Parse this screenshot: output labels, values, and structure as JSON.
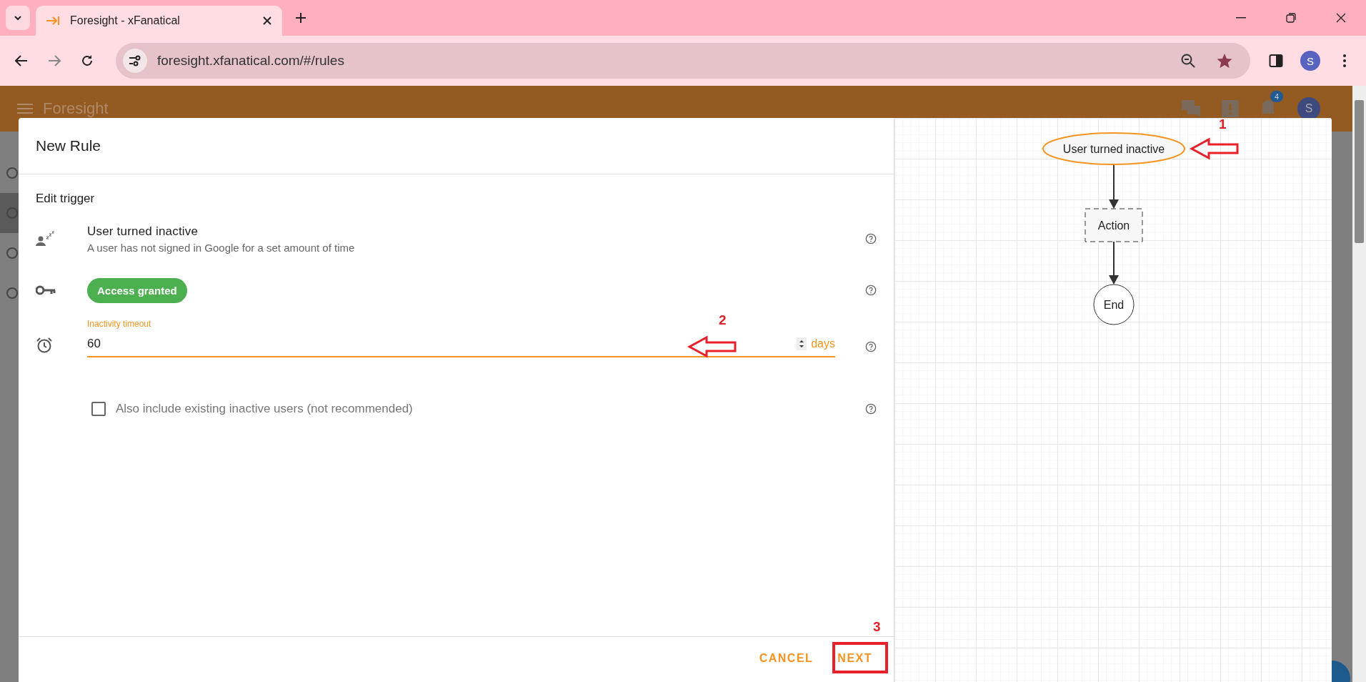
{
  "browser": {
    "tab_title": "Foresight - xFanatical",
    "url": "foresight.xfanatical.com/#/rules",
    "profile": "S"
  },
  "app_header": {
    "title": "Foresight",
    "notification_count": "4",
    "avatar": "S"
  },
  "sidebar": {
    "items": [
      {
        "selected": false
      },
      {
        "selected": true
      },
      {
        "selected": false
      },
      {
        "selected": false
      }
    ]
  },
  "dialog": {
    "title": "New Rule",
    "section": "Edit trigger",
    "trigger": {
      "title": "User turned inactive",
      "description": "A user has not signed in Google for a set amount of time"
    },
    "access": {
      "label": "Access granted"
    },
    "field": {
      "label": "Inactivity timeout",
      "value": "60",
      "unit": "days"
    },
    "checkbox": {
      "label": "Also include existing inactive users (not recommended)",
      "checked": false
    },
    "buttons": [
      {
        "label": "CANCEL"
      },
      {
        "label": "NEXT"
      }
    ],
    "diagram": {
      "nodes": [
        {
          "kind": "trigger",
          "label": "User turned inactive",
          "selected": true
        },
        {
          "kind": "action",
          "label": "Action",
          "selected": false
        },
        {
          "kind": "end",
          "label": "End",
          "selected": false
        }
      ]
    }
  },
  "annotations": [
    {
      "label": "1",
      "kind": "arrow"
    },
    {
      "label": "2",
      "kind": "arrow"
    },
    {
      "label": "3",
      "kind": "frame"
    }
  ]
}
